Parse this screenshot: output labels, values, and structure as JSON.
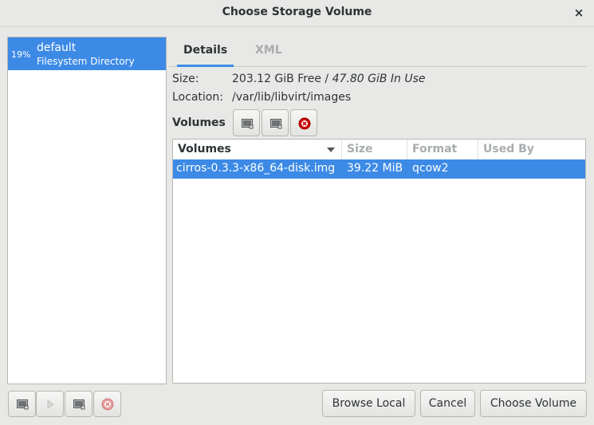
{
  "window": {
    "title": "Choose Storage Volume",
    "close": "×"
  },
  "pools": [
    {
      "percent": "19%",
      "name": "default",
      "type": "Filesystem Directory"
    }
  ],
  "tabs": {
    "details": "Details",
    "xml": "XML"
  },
  "details": {
    "size_label": "Size:",
    "size_free": "203.12 GiB Free",
    "size_sep": " / ",
    "size_used": "47.80 GiB In Use",
    "location_label": "Location:",
    "location_value": "/var/lib/libvirt/images",
    "volumes_label": "Volumes"
  },
  "volume_table": {
    "columns": [
      "Volumes",
      "Size",
      "Format",
      "Used By"
    ],
    "rows": [
      {
        "name": "cirros-0.3.3-x86_64-disk.img",
        "size": "39.22 MiB",
        "format": "qcow2",
        "used_by": ""
      }
    ]
  },
  "buttons": {
    "browse_local": "Browse Local",
    "cancel": "Cancel",
    "choose_volume": "Choose Volume"
  },
  "colors": {
    "selection": "#3c8ae6",
    "delete_red": "#cc0000"
  },
  "icons": [
    "new-volume-icon",
    "refresh-icon",
    "delete-icon",
    "add-pool-icon",
    "start-pool-icon",
    "stop-pool-icon"
  ]
}
